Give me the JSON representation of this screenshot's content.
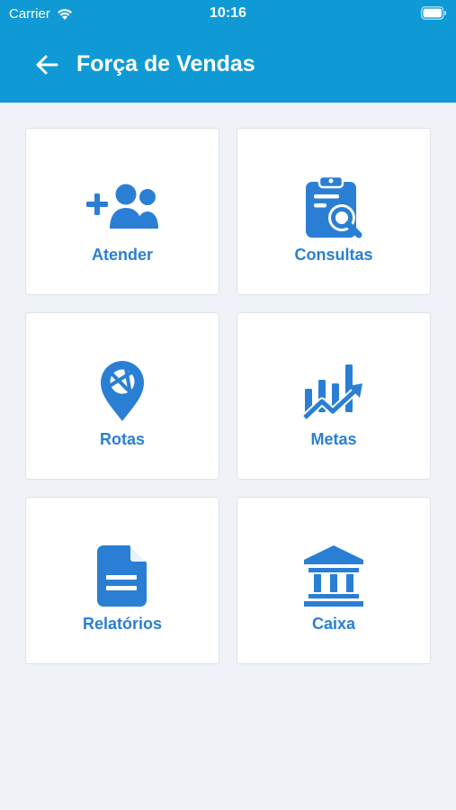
{
  "status_bar": {
    "carrier": "Carrier",
    "time": "10:16"
  },
  "header": {
    "title": "Força de Vendas",
    "back_icon": "arrow-left-icon"
  },
  "colors": {
    "header_bg": "#0f9ad6",
    "accent": "#2a7fd4",
    "page_bg": "#eff2f7"
  },
  "menu": {
    "items": [
      {
        "label": "Atender",
        "icon": "add-users-icon"
      },
      {
        "label": "Consultas",
        "icon": "clipboard-search-icon"
      },
      {
        "label": "Rotas",
        "icon": "map-pin-icon"
      },
      {
        "label": "Metas",
        "icon": "chart-growth-icon"
      },
      {
        "label": "Relatórios",
        "icon": "document-icon"
      },
      {
        "label": "Caixa",
        "icon": "bank-icon"
      }
    ]
  }
}
